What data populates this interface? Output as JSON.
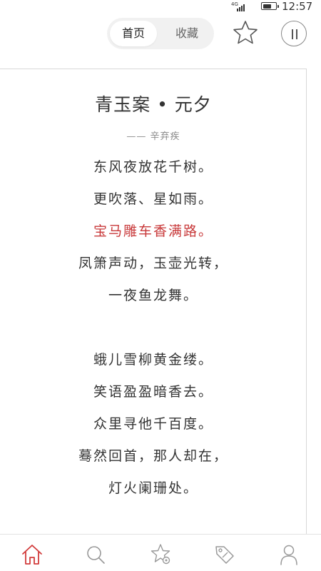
{
  "status_bar": {
    "network": "4G",
    "signal_level": 4,
    "battery_level": 0.7,
    "time": "12:57"
  },
  "header": {
    "tabs": [
      {
        "label": "首页",
        "active": true
      },
      {
        "label": "收藏",
        "active": false
      }
    ],
    "favorite_icon": "star-outline-icon",
    "pause_icon": "pause-icon"
  },
  "poem": {
    "title": "青玉案 • 元夕",
    "author": "—— 辛弃疾",
    "lines": [
      "东风夜放花千树。",
      "更吹落、星如雨。",
      "宝马雕车香满路。",
      "凤箫声动，玉壶光转，",
      "一夜鱼龙舞。",
      "",
      "蛾儿雪柳黄金缕。",
      "笑语盈盈暗香去。",
      "众里寻他千百度。",
      "蓦然回首，那人却在，",
      "灯火阑珊处。"
    ],
    "highlight_index": 2,
    "highlight_color": "#c8393a"
  },
  "bottom_nav": {
    "items": [
      {
        "icon": "home-icon",
        "active": true
      },
      {
        "icon": "search-icon",
        "active": false
      },
      {
        "icon": "star-settings-icon",
        "active": false
      },
      {
        "icon": "tag-icon",
        "active": false
      },
      {
        "icon": "user-icon",
        "active": false
      }
    ],
    "active_color": "#d23c3c",
    "inactive_color": "#999999"
  }
}
